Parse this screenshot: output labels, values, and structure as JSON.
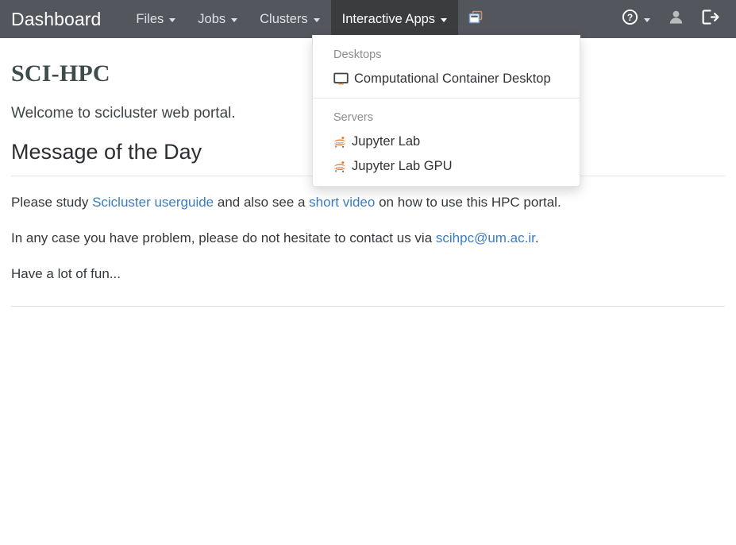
{
  "navbar": {
    "brand": "Dashboard",
    "items": [
      {
        "label": "Files",
        "has_caret": true,
        "active": false
      },
      {
        "label": "Jobs",
        "has_caret": true,
        "active": false
      },
      {
        "label": "Clusters",
        "has_caret": true,
        "active": false
      },
      {
        "label": "Interactive Apps",
        "has_caret": true,
        "active": true
      }
    ],
    "window_icon_name": "clone-windows-icon",
    "right_items": [
      {
        "icon": "help-circle-icon",
        "has_caret": true
      },
      {
        "icon": "user-icon",
        "has_caret": false
      },
      {
        "icon": "logout-icon",
        "has_caret": false
      }
    ],
    "background_color": "#53565c",
    "active_background_color": "#3b3c3e"
  },
  "dropdown": {
    "sections": [
      {
        "header": "Desktops",
        "items": [
          {
            "label": "Computational Container Desktop",
            "icon": "monitor-icon"
          }
        ]
      },
      {
        "header": "Servers",
        "items": [
          {
            "label": "Jupyter Lab",
            "icon": "jupyter-icon"
          },
          {
            "label": "Jupyter Lab GPU",
            "icon": "jupyter-icon"
          }
        ]
      }
    ]
  },
  "main": {
    "page_title": "SCI-HPC",
    "welcome": "Welcome to scicluster web portal.",
    "motd_title": "Message of the Day",
    "paragraph1": {
      "part1": "Please study ",
      "link1": "Scicluster userguide",
      "part2": " and also see a ",
      "link2": "short video",
      "part3": " on how to use this HPC portal."
    },
    "paragraph2": {
      "part1": "In any case you have problem, please do not hesitate to contact us via ",
      "link1": "scihpc@um.ac.ir",
      "part2": "."
    },
    "paragraph3": "Have a lot of fun...",
    "link_color": "#3a7cc4"
  }
}
